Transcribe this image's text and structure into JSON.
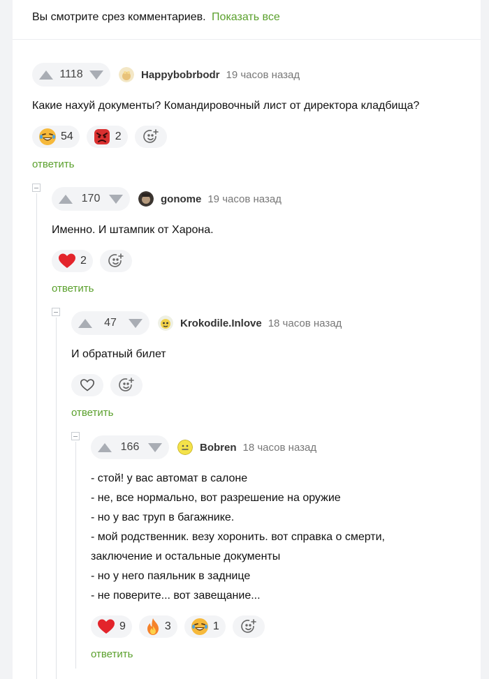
{
  "header": {
    "text": "Вы смотрите срез комментариев.",
    "show_all": "Показать все"
  },
  "comments": [
    {
      "votes": "1118",
      "author": "Happybobrbodr",
      "time": "19 часов назад",
      "text": [
        "Какие нахуй документы? Командировочный лист от директора кладбища?"
      ],
      "reactions": [
        {
          "icon": "laughing-emoji-icon",
          "count": "54"
        },
        {
          "icon": "angry-emoji-icon",
          "count": "2"
        }
      ],
      "reply": "ответить"
    },
    {
      "votes": "170",
      "author": "gonome",
      "time": "19 часов назад",
      "text": [
        "Именно. И штампик от Харона."
      ],
      "reactions": [
        {
          "icon": "heart-icon",
          "count": "2"
        }
      ],
      "reply": "ответить"
    },
    {
      "votes": "47",
      "author": "Krokodile.Inlove",
      "time": "18 часов назад",
      "text": [
        "И обратный билет"
      ],
      "reactions": [
        {
          "icon": "heart-outline-icon",
          "count": ""
        }
      ],
      "reply": "ответить"
    },
    {
      "votes": "166",
      "author": "Bobren",
      "time": "18 часов назад",
      "text": [
        "- стой! у вас автомат в салоне",
        "- не, все нормально, вот разрешение на оружие",
        "- но у вас труп в багажнике.",
        "- мой родственник. везу хоронить. вот справка о смерти,",
        "заключение и остальные документы",
        "- но у него паяльник в заднице",
        "- не поверите... вот завещание..."
      ],
      "reactions": [
        {
          "icon": "heart-icon",
          "count": "9"
        },
        {
          "icon": "fire-icon",
          "count": "3"
        },
        {
          "icon": "laughing-emoji-icon",
          "count": "1"
        }
      ],
      "reply": "ответить"
    }
  ],
  "colors": {
    "accent_green": "#5aa02c",
    "heart_red": "#e3242b",
    "vote_arrow": "#a9adb4"
  }
}
